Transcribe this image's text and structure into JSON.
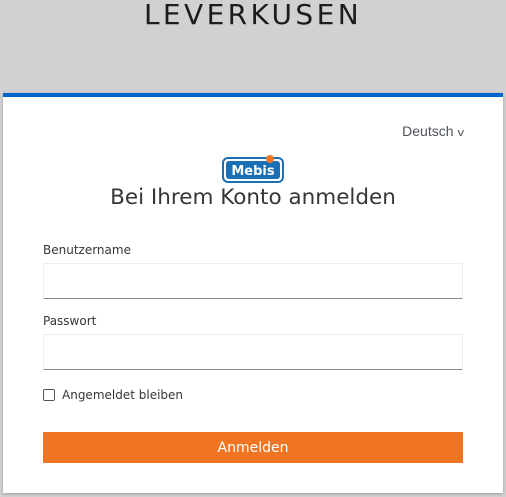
{
  "realm": {
    "title": "LEVERKUSEN"
  },
  "language": {
    "selected": "Deutsch"
  },
  "logo": {
    "text": "Mebis"
  },
  "login": {
    "heading": "Bei Ihrem Konto anmelden",
    "username_label": "Benutzername",
    "username_value": "",
    "password_label": "Passwort",
    "password_value": "",
    "remember_label": "Angemeldet bleiben",
    "remember_checked": false,
    "submit_label": "Anmelden"
  },
  "colors": {
    "accent_blue": "#0066cc",
    "button_orange": "#ef7522",
    "logo_blue": "#1a6fb5",
    "logo_orange": "#ef7522"
  }
}
